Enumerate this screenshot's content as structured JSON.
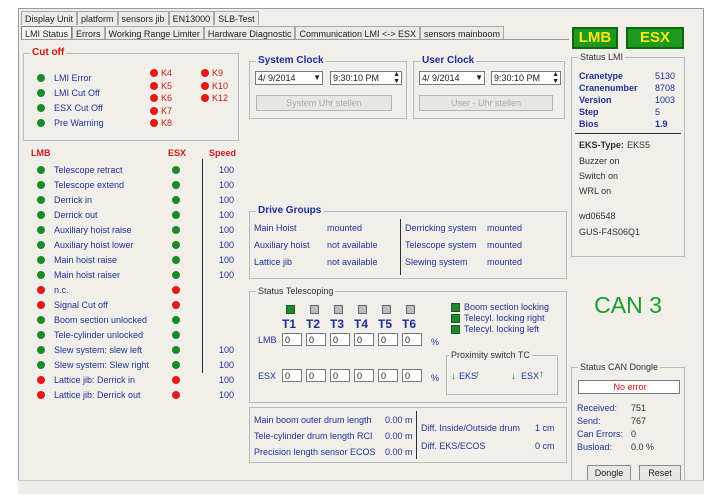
{
  "top_tabs": [
    "Display Unit",
    "platform",
    "sensors jib",
    "EN13000",
    "SLB-Test"
  ],
  "sub_tabs": [
    "LMI Status",
    "Errors",
    "Working Range Limiter",
    "Hardware Diagnostic",
    "Communication  LMI <-> ESX",
    "sensors mainboom"
  ],
  "badges": {
    "lmb": "LMB",
    "esx": "ESX"
  },
  "cutoff": {
    "title": "Cut off",
    "items": [
      {
        "label": "LMI Error",
        "color": "green"
      },
      {
        "label": "LMI Cut Off",
        "color": "green"
      },
      {
        "label": "ESX Cut Off",
        "color": "green"
      },
      {
        "label": "Pre Warning",
        "color": "green"
      }
    ],
    "k_col1": [
      "K4",
      "K5",
      "K6",
      "K7",
      "K8"
    ],
    "k_col2": [
      "K9",
      "K10",
      "K12"
    ]
  },
  "functions": {
    "headers": {
      "lmb": "LMB",
      "esx": "ESX",
      "speed": "Speed"
    },
    "rows": [
      {
        "label": "Telescope retract",
        "lmb": "green",
        "esx": "green",
        "speed": "100"
      },
      {
        "label": "Telescope extend",
        "lmb": "green",
        "esx": "green",
        "speed": "100"
      },
      {
        "label": "Derrick in",
        "lmb": "green",
        "esx": "green",
        "speed": "100"
      },
      {
        "label": "Derrick out",
        "lmb": "green",
        "esx": "green",
        "speed": "100"
      },
      {
        "label": "Auxiliary hoist raise",
        "lmb": "green",
        "esx": "green",
        "speed": "100"
      },
      {
        "label": "Auxiliary hoist lower",
        "lmb": "green",
        "esx": "green",
        "speed": "100"
      },
      {
        "label": "Main hoist raise",
        "lmb": "green",
        "esx": "green",
        "speed": "100"
      },
      {
        "label": "Main hoist raiser",
        "lmb": "green",
        "esx": "green",
        "speed": "100"
      },
      {
        "label": "n.c.",
        "lmb": "red",
        "esx": "red",
        "speed": ""
      },
      {
        "label": "Signal Cut off",
        "lmb": "red",
        "esx": "red",
        "speed": ""
      },
      {
        "label": "Boom section unlocked",
        "lmb": "green",
        "esx": "green",
        "speed": ""
      },
      {
        "label": "Tele-cylinder unlocked",
        "lmb": "green",
        "esx": "green",
        "speed": ""
      },
      {
        "label": "Slew system: slew left",
        "lmb": "green",
        "esx": "green",
        "speed": "100"
      },
      {
        "label": "Slew system: Slew right",
        "lmb": "green",
        "esx": "green",
        "speed": "100"
      },
      {
        "label": "Lattice jib: Derrick in",
        "lmb": "red",
        "esx": "red",
        "speed": "100"
      },
      {
        "label": "Lattice jib: Derrick out",
        "lmb": "red",
        "esx": "red",
        "speed": "100"
      }
    ]
  },
  "system_clock": {
    "title": "System Clock",
    "date": "4/ 9/2014",
    "time": "9:30:10 PM",
    "button": "System Uhr stellen"
  },
  "user_clock": {
    "title": "User Clock",
    "date": "4/ 9/2014",
    "time": "9:30:10 PM",
    "button": "User - Uhr stellen"
  },
  "drive_groups": {
    "title": "Drive Groups",
    "left": [
      {
        "name": "Main Hoist",
        "value": "mounted"
      },
      {
        "name": "Auxiliary hoist",
        "value": "not available"
      },
      {
        "name": "Lattice jib",
        "value": "not available"
      }
    ],
    "right": [
      {
        "name": "Derricking system",
        "value": "mounted"
      },
      {
        "name": "Telescope system",
        "value": "mounted"
      },
      {
        "name": "Slewing system",
        "value": "mounted"
      }
    ]
  },
  "telescoping": {
    "title": "Status Telescoping",
    "t_labels": [
      "T1",
      "T2",
      "T3",
      "T4",
      "T5",
      "T6"
    ],
    "t_states": [
      "on",
      "off",
      "off",
      "off",
      "off",
      "off"
    ],
    "lmb_label": "LMB",
    "esx_label": "ESX",
    "lmb_values": [
      "0",
      "0",
      "0",
      "0",
      "0",
      "0"
    ],
    "esx_values": [
      "0",
      "0",
      "0",
      "0",
      "0",
      "0"
    ],
    "percent": "%",
    "lockings": [
      "Boom section locking",
      "Telecyl. locking right",
      "Telecyl. locking left"
    ],
    "proximity_title": "Proximity switch TC",
    "eks": "EKS",
    "esx": "ESX"
  },
  "measurements": [
    {
      "label": "Main boom outer drum length",
      "value": "0.00 m"
    },
    {
      "label": "Tele-cylinder drum length RCI",
      "value": "0.00 m"
    },
    {
      "label": "Precision length sensor ECOS",
      "value": "0.00 m"
    }
  ],
  "diffs": [
    {
      "label": "Diff. Inside/Outside drum",
      "value": "1 cm"
    },
    {
      "label": "Diff. EKS/ECOS",
      "value": "0 cm"
    }
  ],
  "status_lmi": {
    "title": "Status LMI",
    "rows": [
      {
        "key": "Cranetype",
        "value": "5130"
      },
      {
        "key": "Cranenumber",
        "value": "8708"
      },
      {
        "key": "Version",
        "value": "1003"
      },
      {
        "key": "Step",
        "value": "5"
      },
      {
        "key": "Bios",
        "value": "1.9"
      }
    ],
    "eks_type_label": "EKS-Type:",
    "eks_type_value": "EKS5",
    "flags": [
      "Buzzer on",
      "Switch on",
      "WRL on"
    ],
    "ids": [
      "wd06548",
      "GUS-F4S06Q1"
    ]
  },
  "can_label": "CAN 3",
  "can_dongle": {
    "title": "Status CAN Dongle",
    "error": "No error",
    "rows": [
      {
        "key": "Received:",
        "value": "751"
      },
      {
        "key": "Send:",
        "value": "767"
      },
      {
        "key": "Can Errors:",
        "value": "0"
      },
      {
        "key": "Busload:",
        "value": "0.0 %"
      }
    ],
    "dongle_button": "Dongle",
    "reset_button": "Reset"
  }
}
